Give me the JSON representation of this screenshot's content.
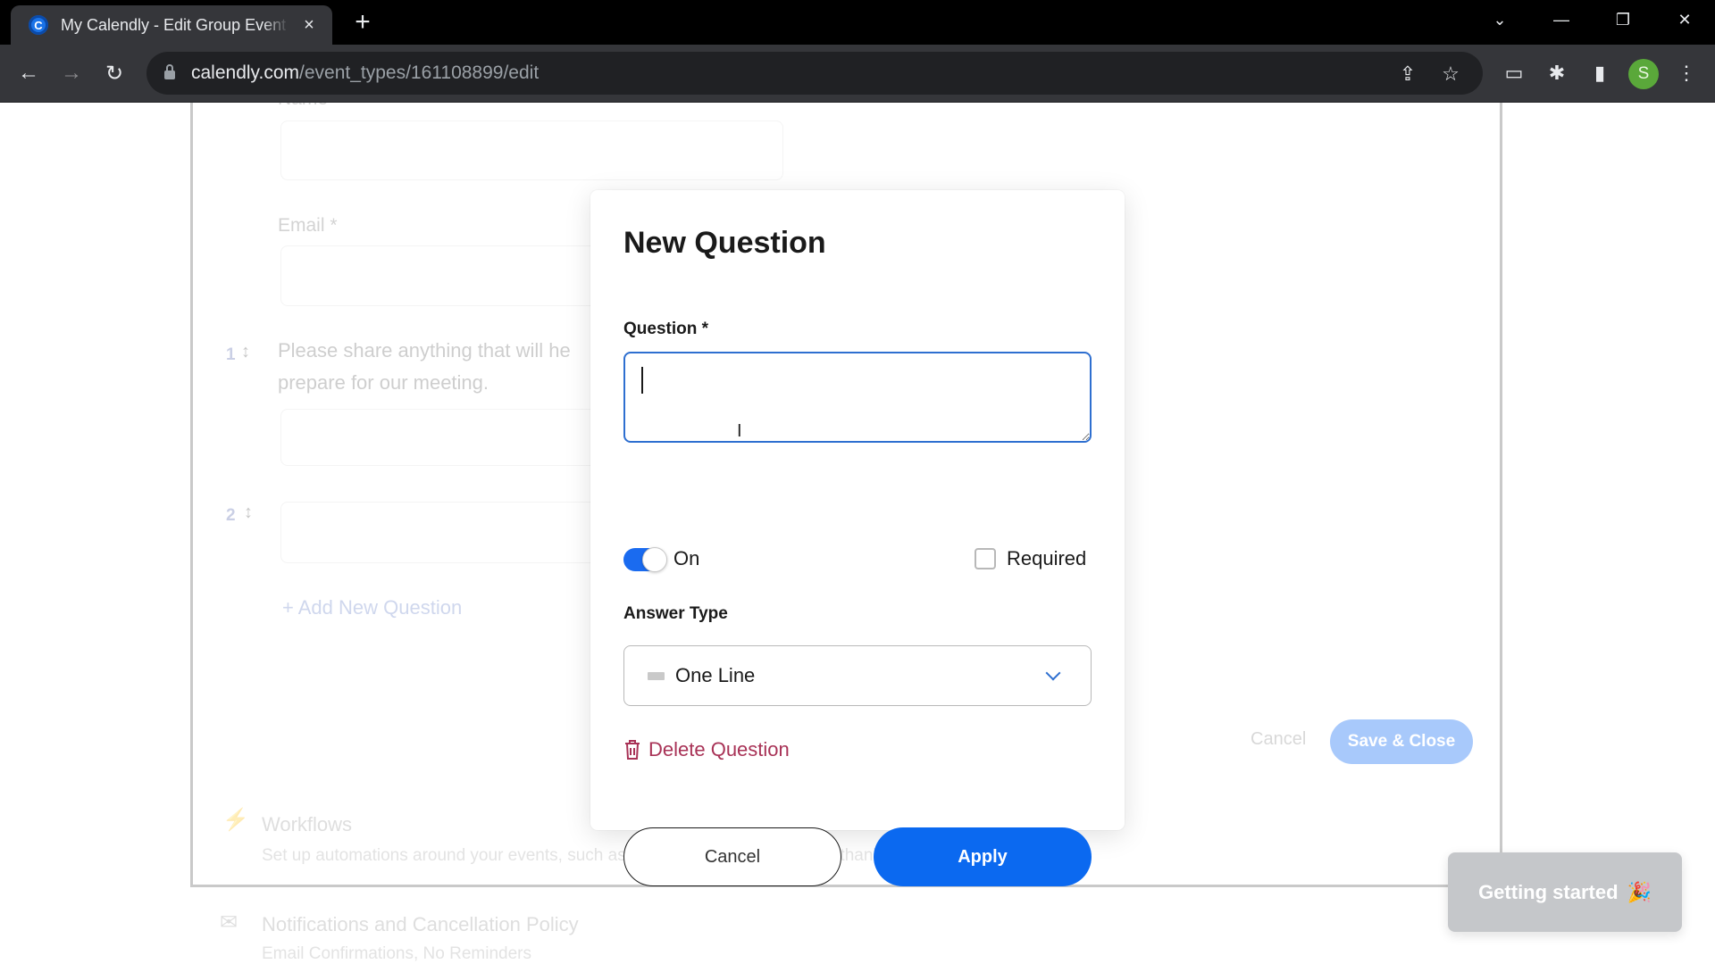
{
  "browser": {
    "tab_title": "My Calendly - Edit Group Event",
    "tab_favicon_letter": "C",
    "tab_close": "×",
    "new_tab": "+",
    "url_host": "calendly.com",
    "url_path": "/event_types/161108899/edit",
    "profile_initial": "S",
    "icons": {
      "back": "←",
      "forward": "→",
      "reload": "↻",
      "share": "⇪",
      "bookmark": "☆",
      "extension_alert": "▭",
      "extensions": "✱",
      "side_panel": "▮",
      "menu": "⋮",
      "tab_search": "⌄",
      "minimize": "—",
      "restore": "❐",
      "close": "✕"
    }
  },
  "background_form": {
    "name_label": "Name *",
    "email_label": "Email *",
    "questions": [
      {
        "number": "1",
        "text_line1": "Please share anything that will he",
        "text_line2": "prepare for our meeting."
      },
      {
        "number": "2",
        "text_line1": "",
        "text_line2": ""
      }
    ],
    "drag_icon": "↕",
    "add_question": "+ Add New Question",
    "cancel_label": "Cancel",
    "save_close_label": "Save & Close",
    "sections": [
      {
        "title": "Workflows",
        "description": "Set up automations around your events, such as email and text notifications, thank you emails, etc.",
        "icon": "⚡"
      },
      {
        "title": "Notifications and Cancellation Policy",
        "description": "Email Confirmations, No Reminders",
        "icon": "✉"
      }
    ]
  },
  "getting_started": {
    "label": "Getting started",
    "icon": "🎉"
  },
  "modal": {
    "title": "New Question",
    "question_label": "Question *",
    "question_value": "",
    "toggle_on": true,
    "toggle_label": "On",
    "required_checked": false,
    "required_label": "Required",
    "answer_type_label": "Answer Type",
    "answer_type_value": "One Line",
    "delete_label": "Delete Question",
    "cancel_label": "Cancel",
    "apply_label": "Apply",
    "colors": {
      "primary": "#0b69f0",
      "danger": "#a83256",
      "focus": "#2e6fd0"
    }
  }
}
